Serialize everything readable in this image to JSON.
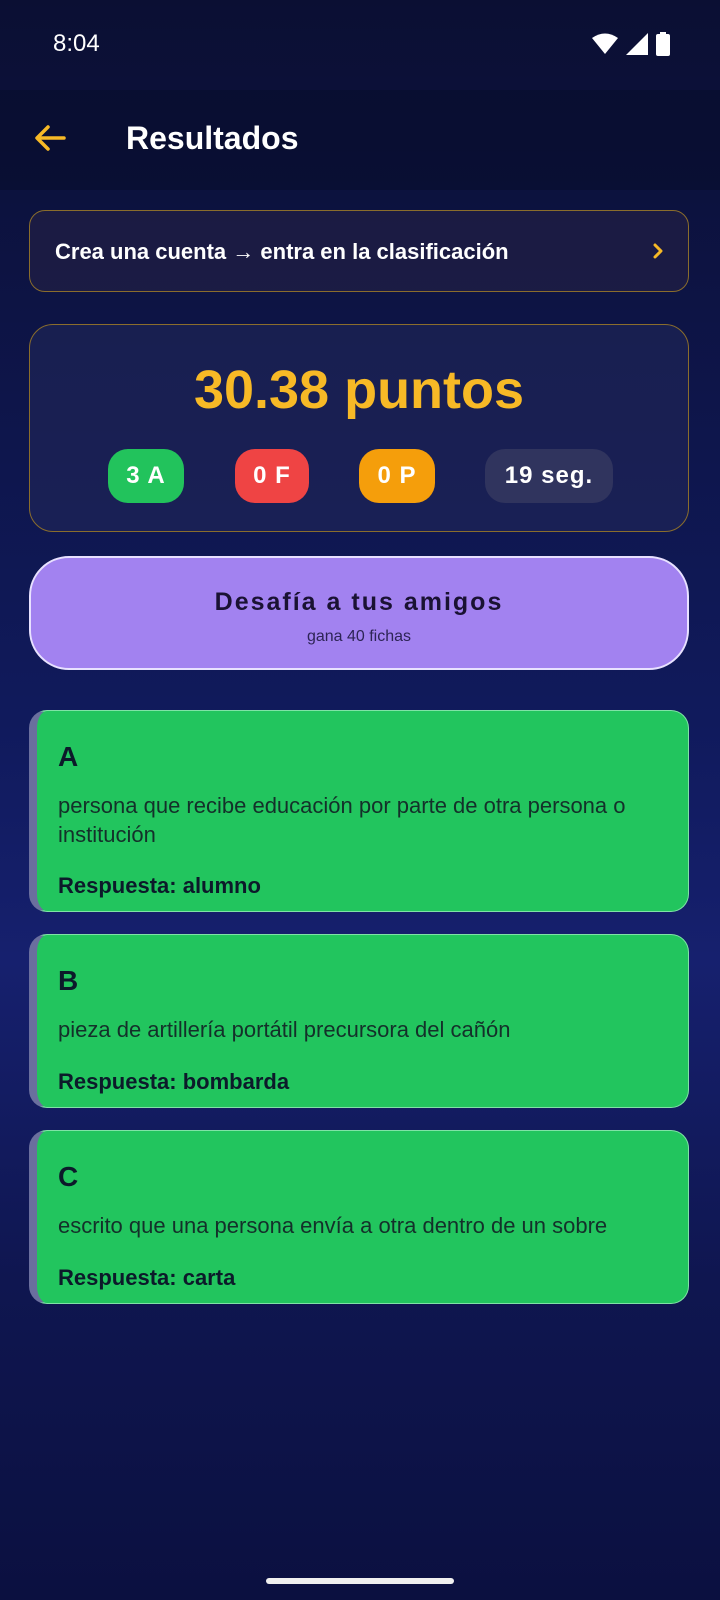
{
  "status_bar": {
    "time": "8:04",
    "icons": [
      "wifi-icon",
      "signal-icon",
      "battery-icon"
    ]
  },
  "header": {
    "title": "Resultados",
    "back_icon": "arrow-left-icon"
  },
  "signup_banner": {
    "text": "Crea una cuenta → entra en la clasificación",
    "chevron": "›"
  },
  "score": {
    "points_label": "30.38 puntos",
    "correct_label": "3 A",
    "wrong_label": "0 F",
    "pass_label": "0 P",
    "time_label": "19 seg."
  },
  "challenge": {
    "title": "Desafía a tus amigos",
    "subtitle": "gana 40 fichas"
  },
  "answers": [
    {
      "letter": "A",
      "definition": "persona que recibe educación por parte de otra persona o institución",
      "answer": "Respuesta: alumno"
    },
    {
      "letter": "B",
      "definition": "pieza de artillería portátil precursora del cañón",
      "answer": "Respuesta: bombarda"
    },
    {
      "letter": "C",
      "definition": "escrito que una persona envía a otra dentro de un sobre",
      "answer": "Respuesta: carta"
    }
  ],
  "colors": {
    "accent_gold": "#f7b926",
    "correct_green": "#22c55e",
    "wrong_red": "#ef4444",
    "pass_orange": "#f59e0b",
    "challenge_purple": "#a282f0"
  }
}
